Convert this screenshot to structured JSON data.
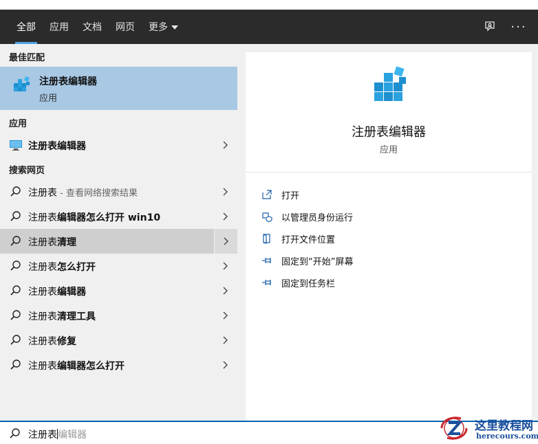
{
  "header": {
    "tabs": [
      {
        "label": "全部",
        "active": true
      },
      {
        "label": "应用"
      },
      {
        "label": "文档"
      },
      {
        "label": "网页"
      },
      {
        "label": "更多"
      }
    ],
    "feedback_icon": "feedback-icon",
    "more_icon": "ellipsis-icon",
    "more_label": "···"
  },
  "left": {
    "best_match_title": "最佳匹配",
    "best_match": {
      "name": "注册表编辑器",
      "type": "应用",
      "icon": "regedit-icon"
    },
    "apps_title": "应用",
    "apps": [
      {
        "name": "注册表编辑器",
        "icon": "monitor-icon"
      }
    ],
    "web_title": "搜索网页",
    "web": [
      {
        "bold": "注册表",
        "rest": "",
        "sub": " - 查看网络搜索结果"
      },
      {
        "bold": "注册表",
        "rest": "编辑器怎么打开 win10",
        "sub": ""
      },
      {
        "bold": "注册表",
        "rest": "清理",
        "sub": ""
      },
      {
        "bold": "注册表",
        "rest": "怎么打开",
        "sub": ""
      },
      {
        "bold": "注册表",
        "rest": "编辑器",
        "sub": ""
      },
      {
        "bold": "注册表",
        "rest": "清理工具",
        "sub": ""
      },
      {
        "bold": "注册表",
        "rest": "修复",
        "sub": ""
      },
      {
        "bold": "注册表",
        "rest": "编辑器怎么打开",
        "sub": ""
      }
    ]
  },
  "right": {
    "title": "注册表编辑器",
    "subtitle": "应用",
    "actions": [
      {
        "label": "打开",
        "icon": "open-icon"
      },
      {
        "label": "以管理员身份运行",
        "icon": "shield-icon"
      },
      {
        "label": "打开文件位置",
        "icon": "file-location-icon"
      },
      {
        "label": "固定到“开始”屏幕",
        "icon": "pin-icon"
      },
      {
        "label": "固定到任务栏",
        "icon": "pin-icon"
      }
    ]
  },
  "search": {
    "typed": "注册表",
    "suggestion": "编辑器"
  },
  "watermark": {
    "title": "这里教程网",
    "url": "herecours.com"
  },
  "colors": {
    "header_bg": "#2b2b2b",
    "accent": "#4ea3e6",
    "best_match_bg": "#a8c8e4",
    "pane_bg": "#f0f0f0",
    "search_border": "#0063b1",
    "watermark_red": "#c8262d",
    "watermark_blue": "#1b4f9c"
  }
}
